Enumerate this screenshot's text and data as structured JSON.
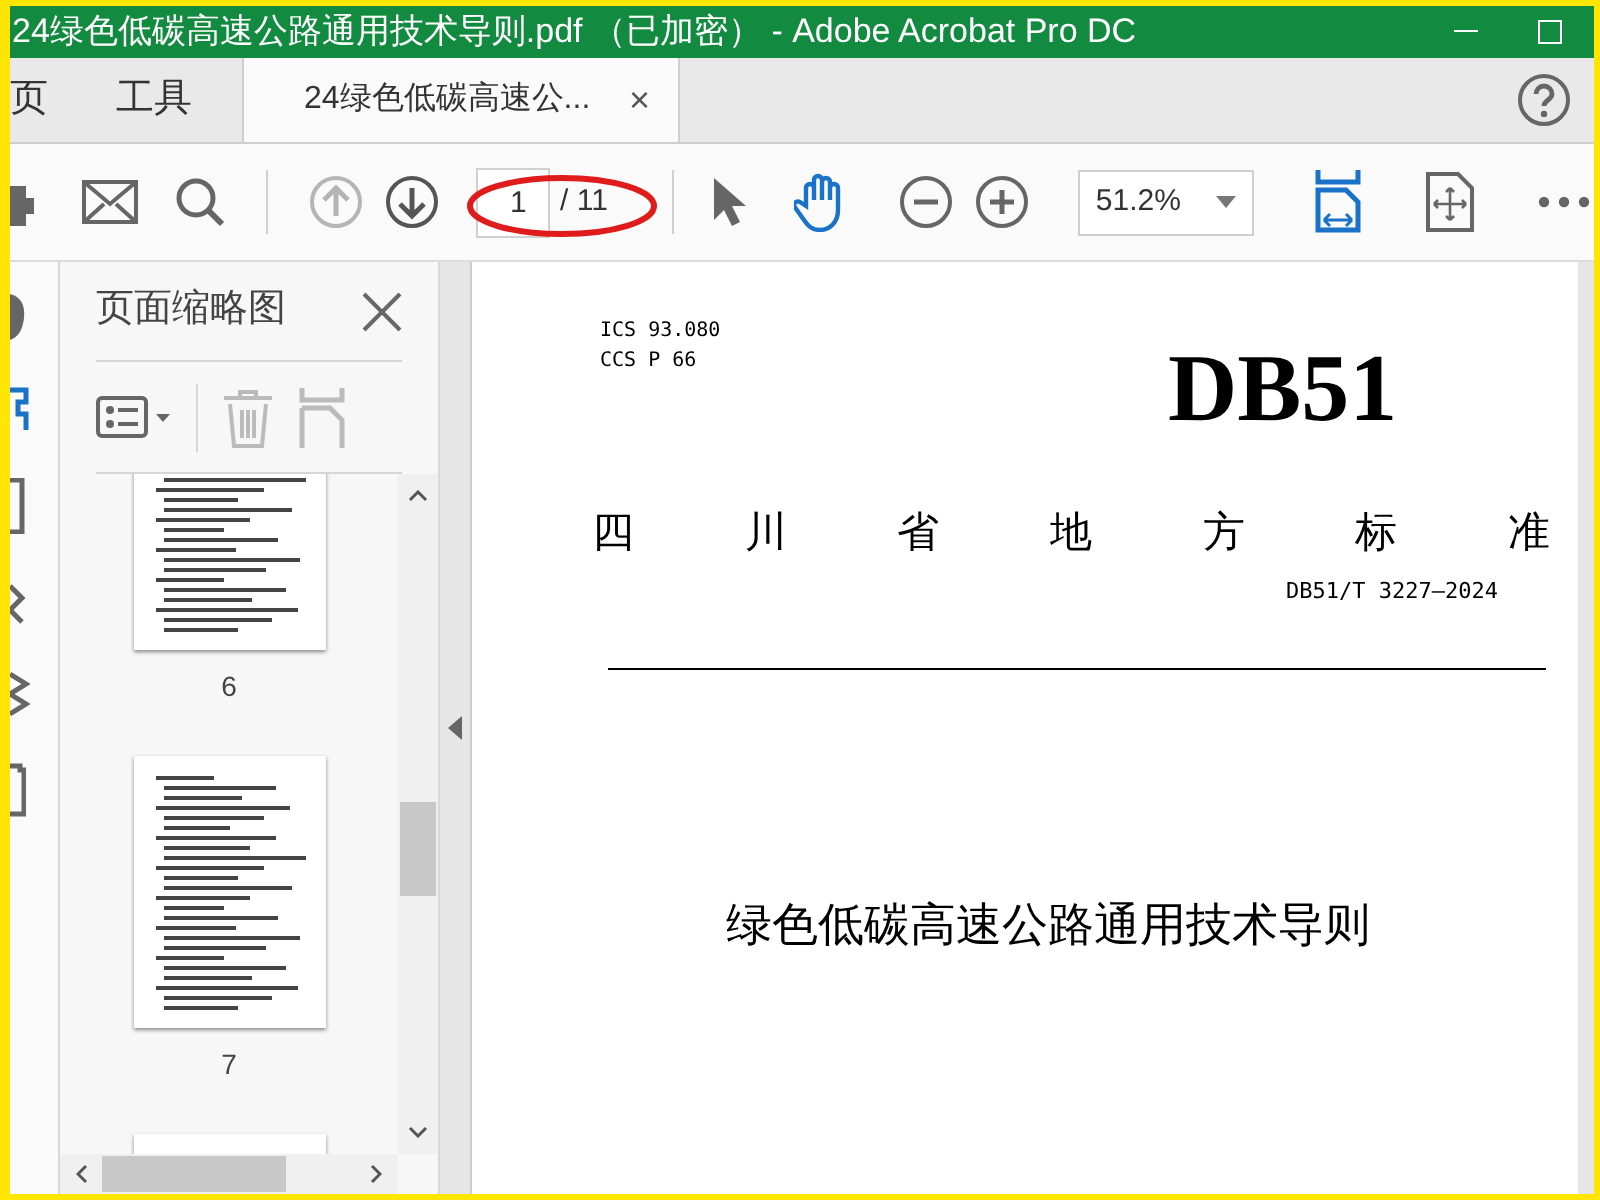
{
  "window": {
    "title": "24绿色低碳高速公路通用技术导则.pdf （已加密） - Adobe Acrobat Pro DC"
  },
  "tabs": [
    {
      "label": "页",
      "selected": false
    },
    {
      "label": "工具",
      "selected": false
    },
    {
      "label": "24绿色低碳高速公...",
      "selected": true,
      "close": "×"
    }
  ],
  "toolbar": {
    "page_number": "1",
    "page_total": "/ 11",
    "zoom": "51.2%"
  },
  "sidebar": {
    "title": "页面缩略图",
    "thumbnails": [
      {
        "label": "6"
      },
      {
        "label": "7"
      }
    ]
  },
  "document": {
    "ics": "ICS 93.080",
    "ccs": "CCS P 66",
    "code": "DB51",
    "heading": "四川省地方标准",
    "standard_number": "DB51/T 3227—2024",
    "title": "绿色低碳高速公路通用技术导则"
  }
}
